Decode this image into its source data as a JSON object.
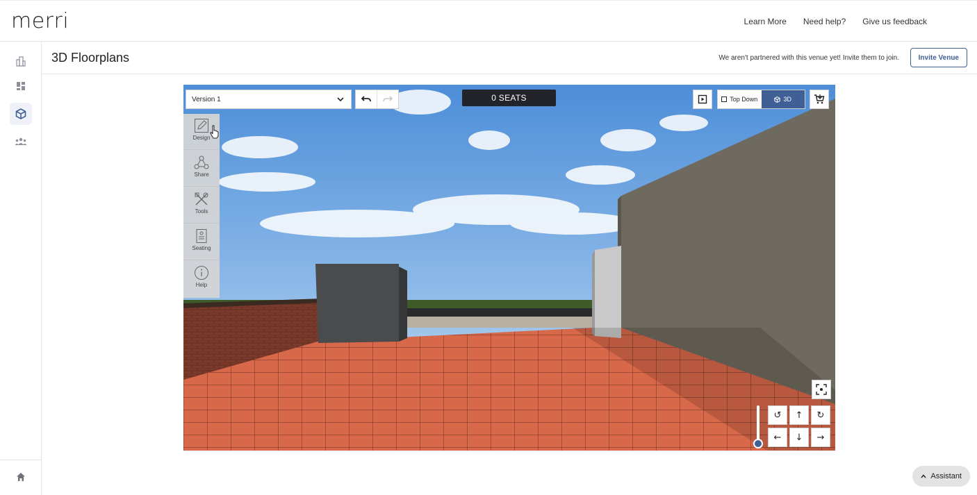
{
  "header": {
    "logo": "merri",
    "links": [
      "Learn More",
      "Need help?",
      "Give us feedback"
    ]
  },
  "sidebar": {
    "items": [
      {
        "icon": "building-icon",
        "active": false
      },
      {
        "icon": "dashboard-icon",
        "active": false
      },
      {
        "icon": "cube-icon",
        "active": true
      },
      {
        "icon": "people-icon",
        "active": false
      }
    ],
    "home_icon": "home-icon"
  },
  "subheader": {
    "title": "3D Floorplans",
    "partner_note": "We aren't partnered with this venue yet! Invite them to join.",
    "invite_label": "Invite Venue"
  },
  "viewer": {
    "version_selected": "Version 1",
    "seats_label": "0 SEATS",
    "view_modes": [
      {
        "label": "Top Down",
        "active": false
      },
      {
        "label": "3D",
        "active": true
      }
    ],
    "tools": [
      {
        "label": "Design",
        "icon": "pencil-icon"
      },
      {
        "label": "Share",
        "icon": "share-icon"
      },
      {
        "label": "Tools",
        "icon": "tools-icon"
      },
      {
        "label": "Seating",
        "icon": "seating-icon"
      },
      {
        "label": "Help",
        "icon": "info-icon"
      }
    ],
    "nav_controls": [
      "rotate-left",
      "up",
      "rotate-right",
      "left",
      "down",
      "right"
    ]
  },
  "assistant_label": "Assistant",
  "colors": {
    "accent": "#3f5f95",
    "seats_bg": "#22242a",
    "sky": "#5f9be0",
    "floor_tile": "#d8684a",
    "brick": "#7a3a2a",
    "wall": "#6f6a5f"
  }
}
